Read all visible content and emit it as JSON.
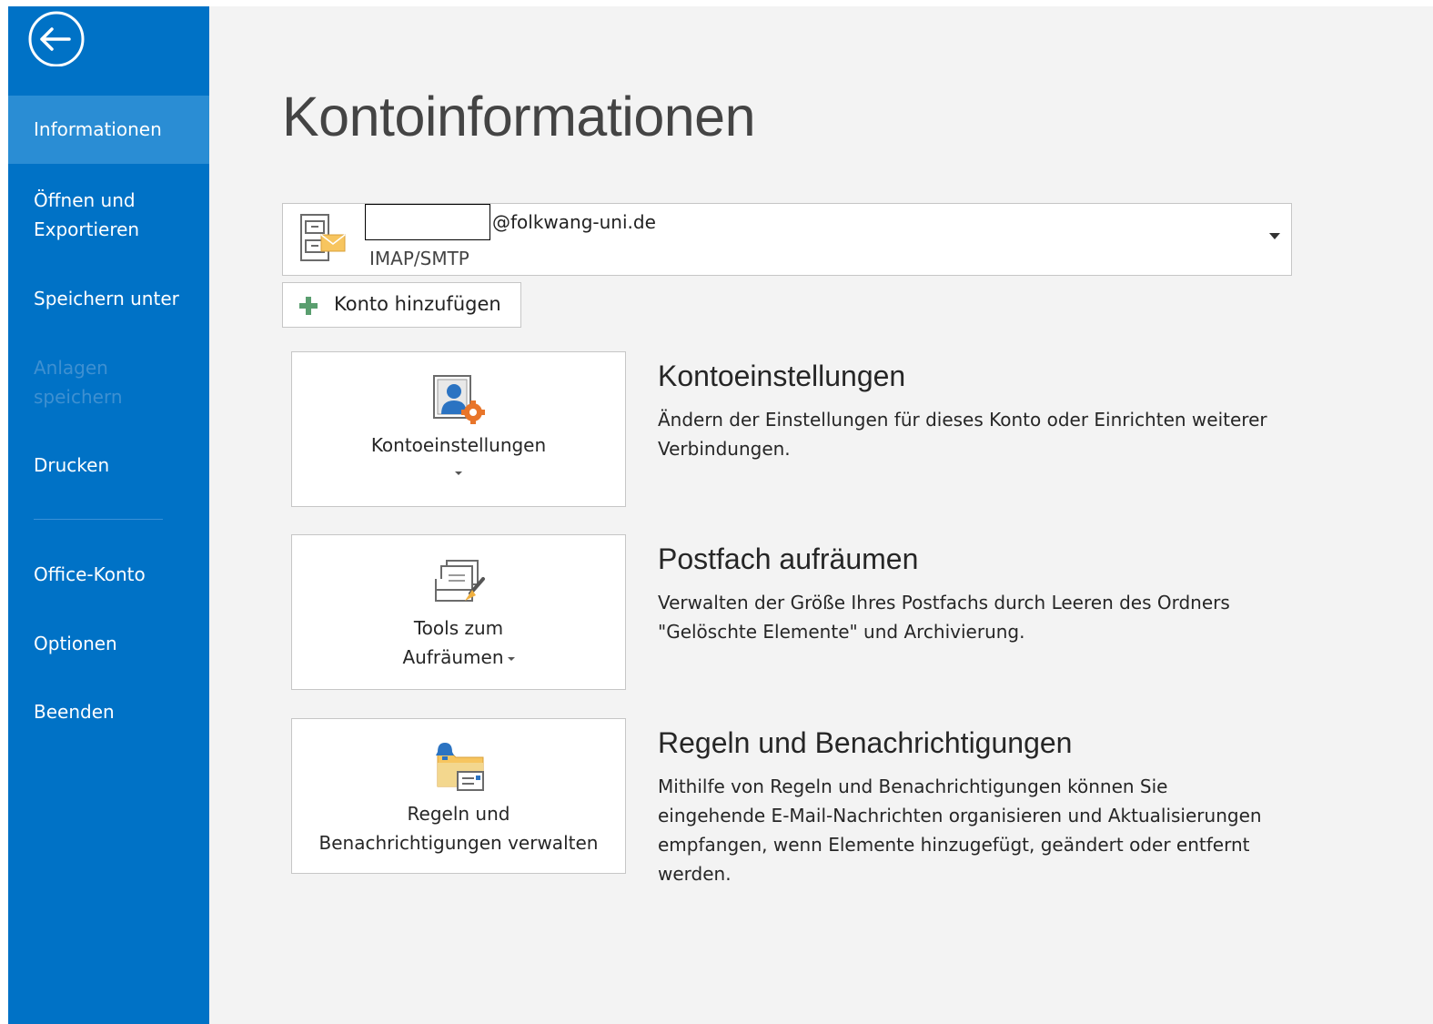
{
  "sidebar": {
    "back_label": "",
    "items": [
      {
        "label": "Informationen",
        "state": "active"
      },
      {
        "label": "Öffnen und Exportieren",
        "state": "normal"
      },
      {
        "label": "Speichern unter",
        "state": "normal"
      },
      {
        "label": "Anlagen speichern",
        "state": "disabled"
      },
      {
        "label": "Drucken",
        "state": "normal"
      },
      {
        "label": "Office-Konto",
        "state": "normal"
      },
      {
        "label": "Optionen",
        "state": "normal"
      },
      {
        "label": "Beenden",
        "state": "normal"
      }
    ]
  },
  "main": {
    "title": "Kontoinformationen",
    "account": {
      "email_domain": "@folkwang-uni.de",
      "type": "IMAP/SMTP"
    },
    "add_account_label": "Konto hinzufügen",
    "sections": [
      {
        "tile_label": "Kontoeinstellungen",
        "heading": "Kontoeinstellungen",
        "description": "Ändern der Einstellungen für dieses Konto oder Einrichten weiterer Verbindungen."
      },
      {
        "tile_label_line1": "Tools zum",
        "tile_label_line2": "Aufräumen",
        "heading": "Postfach aufräumen",
        "description": "Verwalten der Größe Ihres Postfachs durch Leeren des Ordners \"Gelöschte Elemente\" und Archivierung."
      },
      {
        "tile_label_line1": "Regeln und",
        "tile_label_line2": "Benachrichtigungen verwalten",
        "heading": "Regeln und Benachrichtigungen",
        "description": "Mithilfe von Regeln und Benachrichtigungen können Sie eingehende E-Mail-Nachrichten organisieren und Aktualisierungen empfangen, wenn Elemente hinzugefügt, geändert oder entfernt werden."
      }
    ]
  },
  "colors": {
    "sidebar_bg": "#0072c6",
    "sidebar_active": "#2a8dd4",
    "main_bg": "#f3f3f3",
    "accent_orange": "#f0a030"
  }
}
